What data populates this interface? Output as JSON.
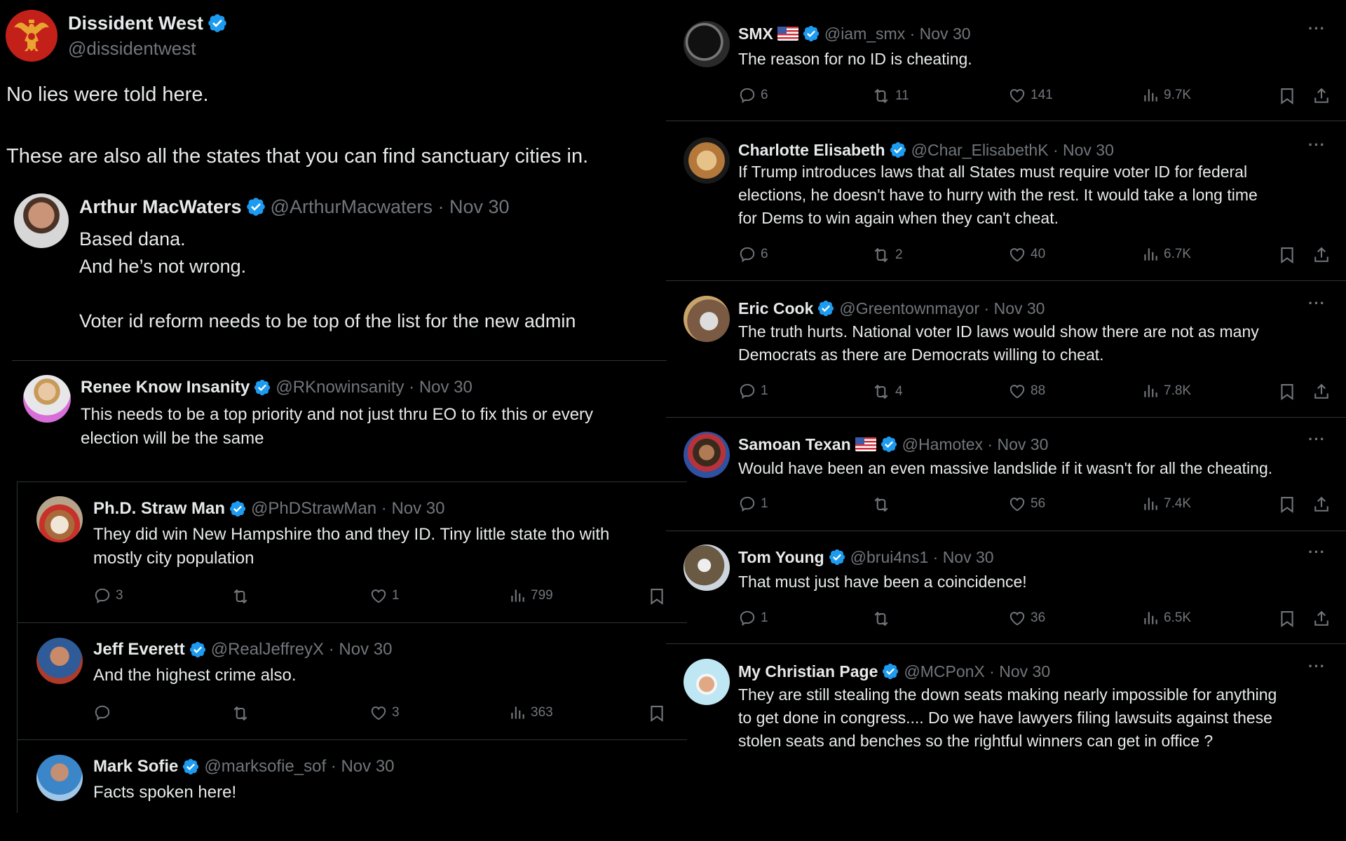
{
  "main_post": {
    "name": "Dissident West",
    "handle": "@dissidentwest",
    "verified": true,
    "text_line1": "No lies were told here.",
    "text_line2": "These are also all the states that you can find sanctuary cities in.",
    "avatar_icon": "double-headed-eagle-icon"
  },
  "quoted_reply": {
    "name": "Arthur MacWaters",
    "handle": "@ArthurMacwaters",
    "date": "Nov 30",
    "text": "Based dana.\nAnd he’s not wrong.\n\nVoter id reform needs to be top of the list for the new admin"
  },
  "left_replies": [
    {
      "name": "Renee Know Insanity",
      "handle": "@RKnowinsanity",
      "date": "Nov 30",
      "text": "This needs to be a top priority and not just thru EO to fix this or every\nelection will be the same"
    },
    {
      "name": "Ph.D. Straw Man",
      "handle": "@PhDStrawMan",
      "date": "Nov 30",
      "text": "They did win New Hampshire tho and they ID.  Tiny little state tho with\nmostly city population",
      "replies": "3",
      "reposts": "",
      "likes": "1",
      "views": "799"
    },
    {
      "name": "Jeff Everett",
      "handle": "@RealJeffreyX",
      "date": "Nov 30",
      "text": "And the highest crime also.",
      "replies": "",
      "reposts": "",
      "likes": "3",
      "views": "363"
    },
    {
      "name": "Mark Sofie",
      "handle": "@marksofie_sof",
      "date": "Nov 30",
      "text": "Facts spoken here!"
    }
  ],
  "right_replies": [
    {
      "name": "SMX",
      "flag": true,
      "handle": "@iam_smx",
      "date": "Nov 30",
      "text": "The reason for no ID is cheating.",
      "replies": "6",
      "reposts": "11",
      "likes": "141",
      "views": "9.7K"
    },
    {
      "name": "Charlotte Elisabeth",
      "flag": false,
      "handle": "@Char_ElisabethK",
      "date": "Nov 30",
      "text": "If Trump introduces laws that all States must require voter ID for federal\nelections, he doesn't have to hurry with the rest. It would take a long time\nfor Dems to win again when they can't cheat.",
      "replies": "6",
      "reposts": "2",
      "likes": "40",
      "views": "6.7K"
    },
    {
      "name": "Eric Cook",
      "flag": false,
      "handle": "@Greentownmayor",
      "date": "Nov 30",
      "text": "The truth hurts.  National voter ID laws would show there are not as many\nDemocrats as there are Democrats willing to cheat.",
      "replies": "1",
      "reposts": "4",
      "likes": "88",
      "views": "7.8K"
    },
    {
      "name": "Samoan Texan",
      "flag": true,
      "handle": "@Hamotex",
      "date": "Nov 30",
      "text": "Would have been an even massive landslide if it wasn't for all the cheating.",
      "replies": "1",
      "reposts": "",
      "likes": "56",
      "views": "7.4K"
    },
    {
      "name": "Tom Young",
      "flag": false,
      "handle": "@brui4ns1",
      "date": "Nov 30",
      "text": "That must just have been a coincidence!",
      "replies": "1",
      "reposts": "",
      "likes": "36",
      "views": "6.5K"
    },
    {
      "name": "My Christian Page",
      "flag": false,
      "handle": "@MCPonX",
      "date": "Nov 30",
      "text": "They are still stealing the down seats making nearly impossible for anything\nto get done in congress.... Do we have lawyers filing lawsuits against these\nstolen seats and benches so the rightful winners can get in office ?"
    }
  ],
  "ui": {
    "separator": " · ",
    "more_label": "···"
  },
  "colors": {
    "background": "#000000",
    "text": "#e7e9ea",
    "muted": "#71767b",
    "divider": "#2f3336",
    "verified": "#1d9bf0"
  }
}
